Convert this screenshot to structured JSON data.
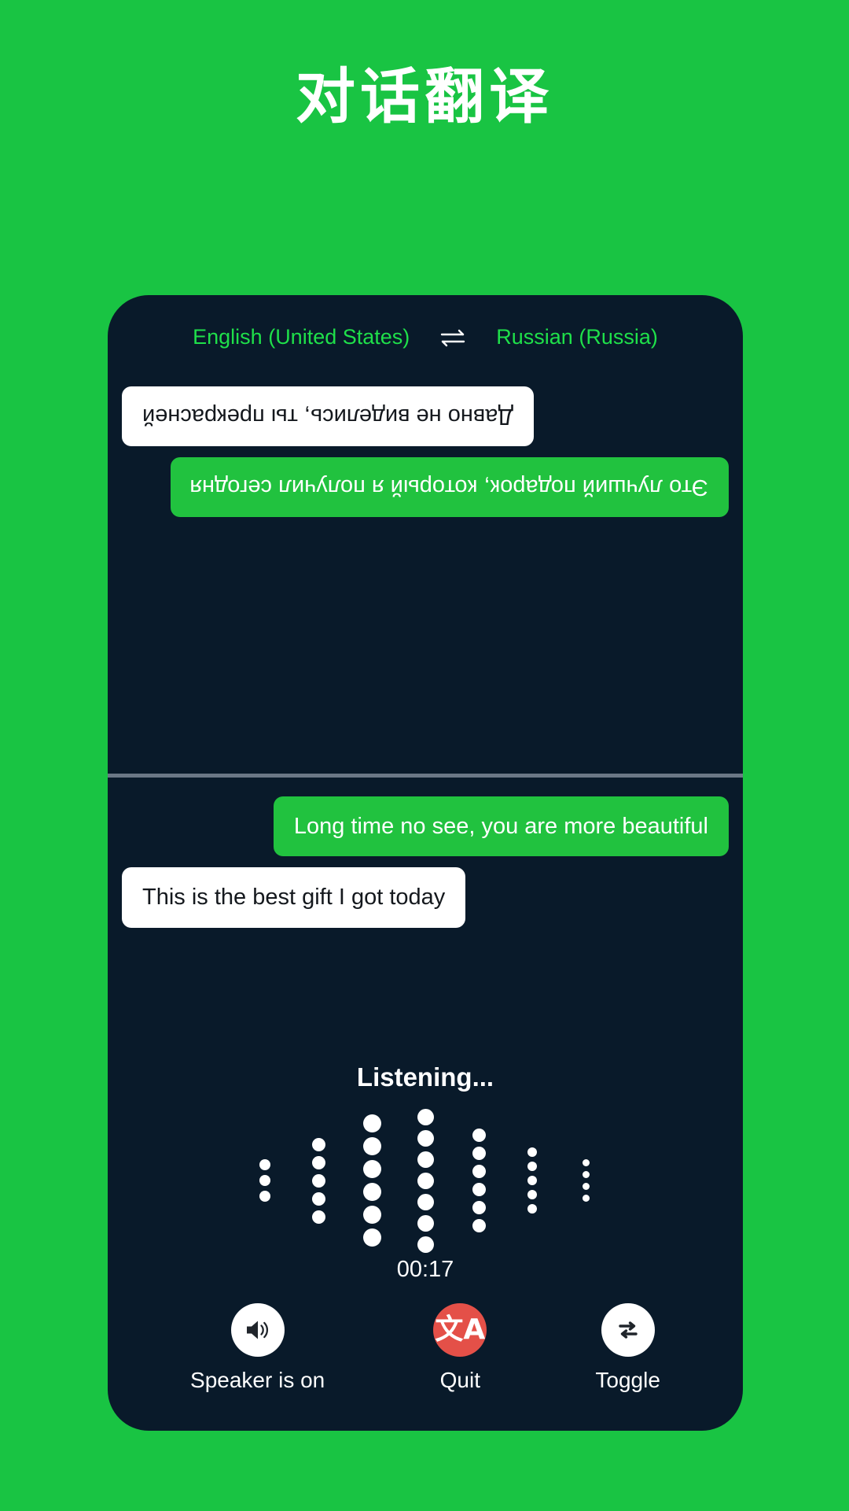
{
  "headline": "对话翻译",
  "colors": {
    "background_green": "#19c443",
    "phone_dark": "#091a2a",
    "bubble_green": "#21c23f",
    "bubble_white": "#ffffff",
    "lang_text_green": "#1fe04a",
    "quit_red": "#e45048",
    "divider_gray": "#6b7886"
  },
  "language_bar": {
    "source": "English (United States)",
    "target": "Russian (Russia)",
    "swap_icon": "swap-horizontal-arrows-icon"
  },
  "conversation": {
    "remote_messages": [
      {
        "text": "Это лучший подарок, который я получил сегодня",
        "style": "green",
        "align": "left"
      },
      {
        "text": "Давно не виделись, ты прекрасней",
        "style": "white",
        "align": "right"
      }
    ],
    "local_messages": [
      {
        "text": "Long time no see, you are more beautiful",
        "style": "green",
        "align": "right"
      },
      {
        "text": "This is the best gift I got today",
        "style": "white",
        "align": "left"
      }
    ]
  },
  "listening": {
    "label": "Listening...",
    "timer": "00:17",
    "waveform": {
      "columns": [
        {
          "dots": 3,
          "size": 14
        },
        {
          "dots": 5,
          "size": 17
        },
        {
          "dots": 6,
          "size": 23
        },
        {
          "dots": 7,
          "size": 21
        },
        {
          "dots": 6,
          "size": 17
        },
        {
          "dots": 5,
          "size": 12
        },
        {
          "dots": 4,
          "size": 9
        }
      ]
    }
  },
  "controls": [
    {
      "label": "Speaker is on",
      "icon": "speaker-on-icon",
      "circle": "white"
    },
    {
      "label": "Quit",
      "icon": "translate-icon",
      "circle": "red"
    },
    {
      "label": "Toggle",
      "icon": "toggle-repeat-icon",
      "circle": "white"
    }
  ]
}
